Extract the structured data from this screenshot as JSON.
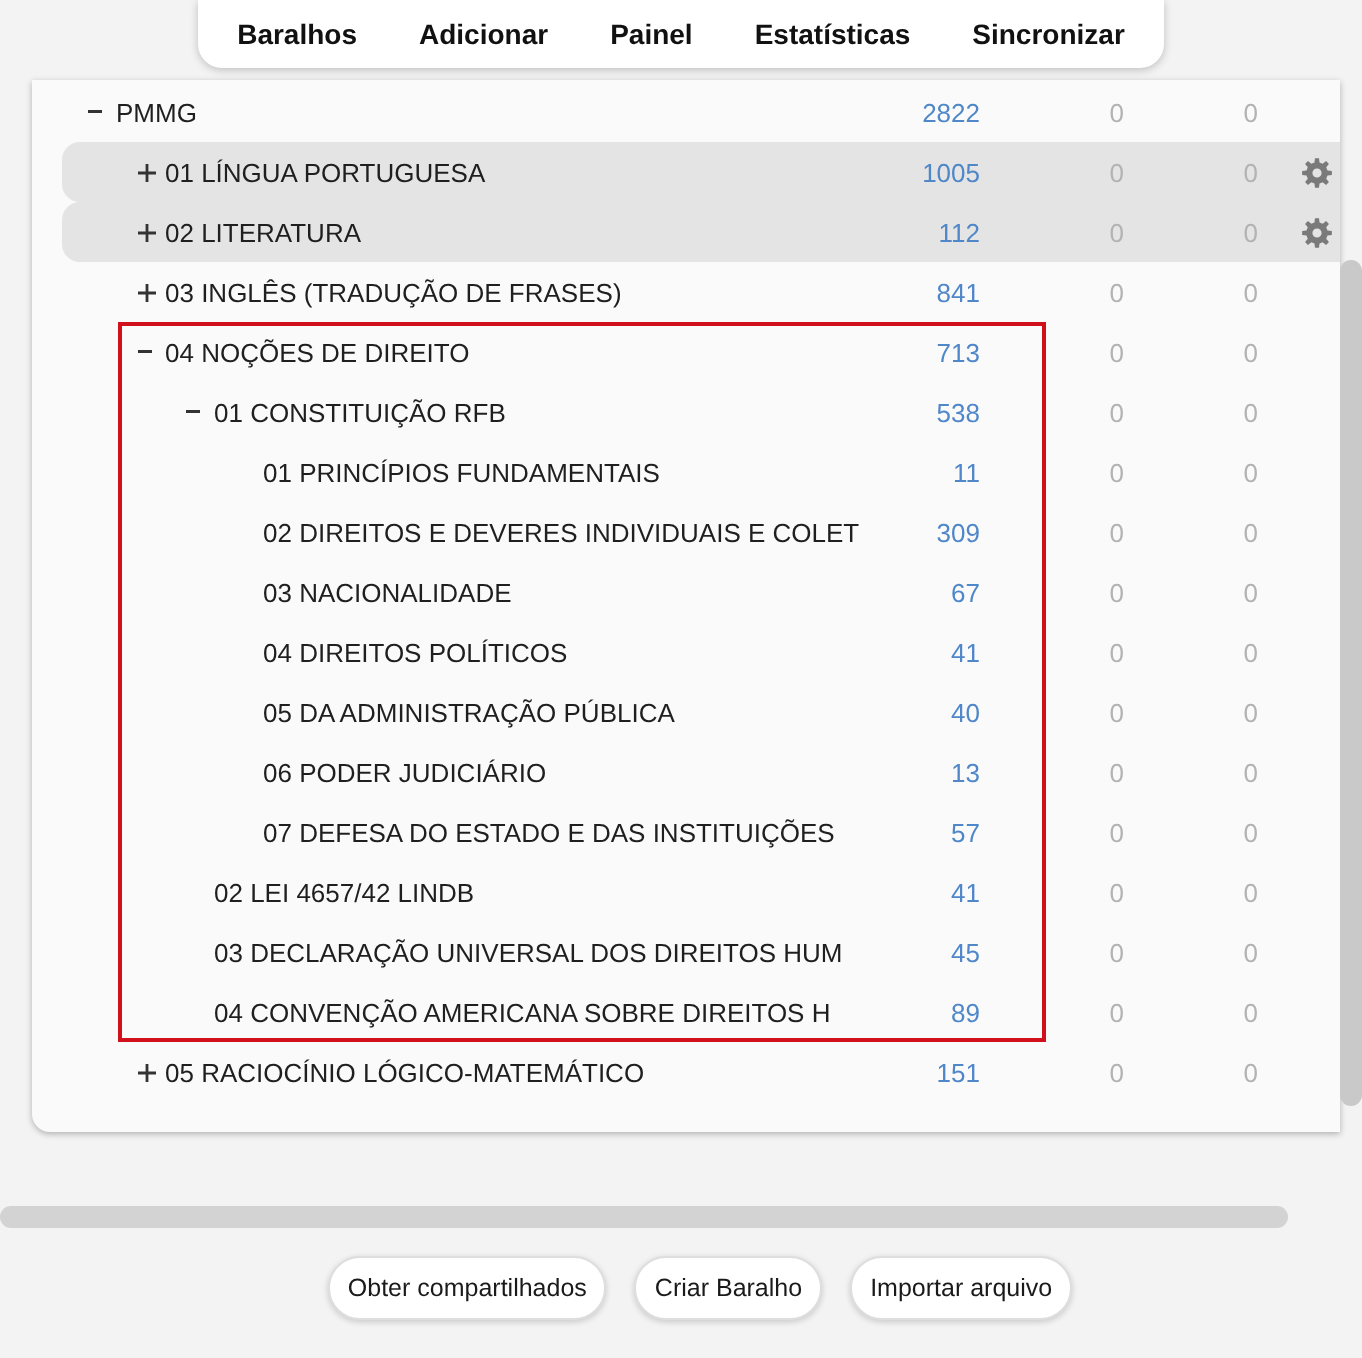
{
  "nav": [
    "Baralhos",
    "Adicionar",
    "Painel",
    "Estatísticas",
    "Sincronizar"
  ],
  "decks": [
    {
      "name": "PMMG",
      "count_1": "2822",
      "count_2": "0",
      "count_3": "0",
      "expanded": true,
      "selected": false,
      "outlined": false,
      "children": [
        {
          "name": "01 LÍNGUA PORTUGUESA",
          "count_1": "1005",
          "count_2": "0",
          "count_3": "0",
          "expanded": false,
          "selected": true,
          "outlined": false
        },
        {
          "name": "02 LITERATURA",
          "count_1": "112",
          "count_2": "0",
          "count_3": "0",
          "expanded": false,
          "selected": true,
          "outlined": false
        },
        {
          "name": "03 INGLÊS (TRADUÇÃO DE FRASES)",
          "count_1": "841",
          "count_2": "0",
          "count_3": "0",
          "expanded": false,
          "selected": false,
          "outlined": false
        },
        {
          "name": "04 NOÇÕES DE DIREITO",
          "count_1": "713",
          "count_2": "0",
          "count_3": "0",
          "expanded": true,
          "selected": false,
          "outlined": true,
          "children": [
            {
              "name": "01 CONSTITUIÇÃO RFB",
              "count_1": "538",
              "count_2": "0",
              "count_3": "0",
              "expanded": true,
              "selected": false,
              "outlined": false,
              "children": [
                {
                  "name": "01 PRINCÍPIOS FUNDAMENTAIS",
                  "count_1": "11",
                  "count_2": "0",
                  "count_3": "0",
                  "selected": false,
                  "outlined": false
                },
                {
                  "name": "02 DIREITOS E DEVERES INDIVIDUAIS E COLET",
                  "count_1": "309",
                  "count_2": "0",
                  "count_3": "0",
                  "selected": false,
                  "outlined": false
                },
                {
                  "name": "03 NACIONALIDADE",
                  "count_1": "67",
                  "count_2": "0",
                  "count_3": "0",
                  "selected": false,
                  "outlined": false
                },
                {
                  "name": "04 DIREITOS POLÍTICOS",
                  "count_1": "41",
                  "count_2": "0",
                  "count_3": "0",
                  "selected": false,
                  "outlined": false
                },
                {
                  "name": "05 DA ADMINISTRAÇÃO PÚBLICA",
                  "count_1": "40",
                  "count_2": "0",
                  "count_3": "0",
                  "selected": false,
                  "outlined": false
                },
                {
                  "name": "06 PODER JUDICIÁRIO",
                  "count_1": "13",
                  "count_2": "0",
                  "count_3": "0",
                  "selected": false,
                  "outlined": false
                },
                {
                  "name": "07 DEFESA DO ESTADO E DAS INSTITUIÇÕES",
                  "count_1": "57",
                  "count_2": "0",
                  "count_3": "0",
                  "selected": false,
                  "outlined": false
                }
              ]
            },
            {
              "name": "02 LEI 4657/42 LINDB",
              "count_1": "41",
              "count_2": "0",
              "count_3": "0",
              "selected": false,
              "outlined": false
            },
            {
              "name": "03 DECLARAÇÃO UNIVERSAL DOS DIREITOS HUM",
              "count_1": "45",
              "count_2": "0",
              "count_3": "0",
              "selected": false,
              "outlined": false
            },
            {
              "name": "04 CONVENÇÃO AMERICANA SOBRE DIREITOS H",
              "count_1": "89",
              "count_2": "0",
              "count_3": "0",
              "selected": false,
              "outlined": false
            }
          ]
        },
        {
          "name": "05 RACIOCÍNIO LÓGICO-MATEMÁTICO",
          "count_1": "151",
          "count_2": "0",
          "count_3": "0",
          "expanded": false,
          "selected": false,
          "outlined": false
        }
      ]
    }
  ],
  "buttons": [
    "Obter compartilhados",
    "Criar Baralho",
    "Importar arquivo"
  ]
}
